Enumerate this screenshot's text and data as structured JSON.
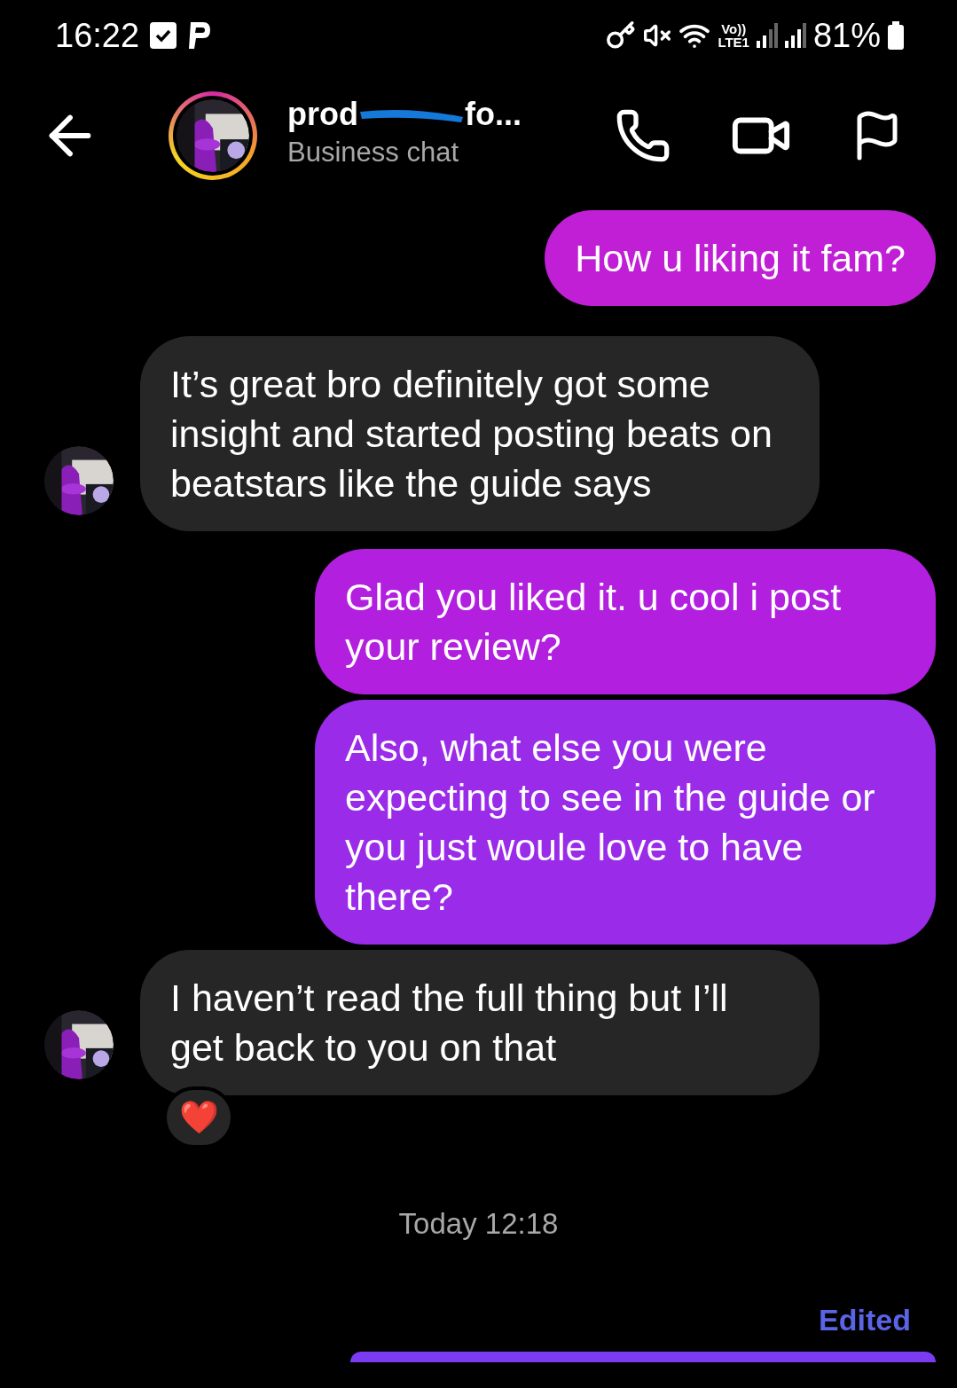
{
  "status_bar": {
    "time": "16:22",
    "signal_lte": "Vo))\nLTE1",
    "battery": "81%"
  },
  "header": {
    "name_start": "prod",
    "name_end": "fo...",
    "subtitle": "Business chat"
  },
  "messages": [
    {
      "kind": "sent",
      "text": "How u liking it fam?",
      "color": "#c11fd6"
    },
    {
      "kind": "received",
      "text": "It’s great bro definitely got some insight and started posting beats on beatstars like the guide says"
    },
    {
      "kind": "sent",
      "text": "Glad you liked it. u cool i post your review?",
      "color": "#b21fdf"
    },
    {
      "kind": "sent",
      "text": "Also, what else you were expecting to see in the guide or you just woule love to have there?",
      "color": "#9a2be9"
    },
    {
      "kind": "received",
      "text": "I haven’t read the full thing but I’ll get back to you on that",
      "reaction": "❤️"
    },
    {
      "kind": "timestamp",
      "text": "Today 12:18"
    },
    {
      "kind": "edited",
      "text": "Edited"
    },
    {
      "kind": "sent_partial",
      "color": "#7b3bf0"
    }
  ]
}
